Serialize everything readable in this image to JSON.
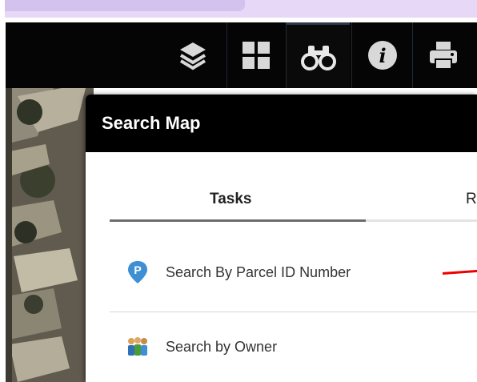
{
  "toolbar": {
    "tools": [
      {
        "name": "layers-icon",
        "interactable": true
      },
      {
        "name": "basemap-gallery-icon",
        "interactable": true
      },
      {
        "name": "binoculars-search-icon",
        "interactable": true,
        "active": true
      },
      {
        "name": "info-icon",
        "interactable": true
      },
      {
        "name": "print-icon",
        "interactable": true
      }
    ]
  },
  "panel": {
    "title": "Search Map",
    "tabs": [
      {
        "label": "Tasks",
        "active": true
      },
      {
        "label": "R",
        "active": false
      }
    ],
    "tasks": [
      {
        "label": "Search By Parcel ID Number",
        "icon": "parcel-pin-icon"
      },
      {
        "label": "Search by Owner",
        "icon": "owner-people-icon"
      }
    ]
  },
  "colors": {
    "toolbar_bg": "#050505",
    "header_bg": "#000000",
    "accent_blue": "#3f8fd4",
    "lavender": "#e6d8f6",
    "annotation_red": "#e00000"
  }
}
